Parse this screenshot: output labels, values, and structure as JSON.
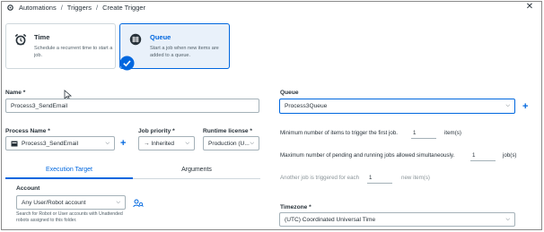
{
  "breadcrumb": {
    "items": [
      "Automations",
      "Triggers",
      "Create Trigger"
    ],
    "separator": "/"
  },
  "close": {
    "glyph": "✕"
  },
  "trigger_types": [
    {
      "title": "Time",
      "description": "Schedule a recurrent time to start a job.",
      "icon": "alarm-clock-icon",
      "selected": false
    },
    {
      "title": "Queue",
      "description": "Start a job when new items are added to a queue.",
      "icon": "queue-icon",
      "selected": true
    }
  ],
  "name": {
    "label": "Name *",
    "value": "Process3_SendEmail"
  },
  "process": {
    "label": "Process Name *",
    "value": "Process3_SendEmail"
  },
  "priority": {
    "label": "Job priority *",
    "value": "→ Inherited"
  },
  "runtime": {
    "label": "Runtime license *",
    "value": "Production (U..."
  },
  "tabs": [
    {
      "label": "Execution Target",
      "active": true
    },
    {
      "label": "Arguments",
      "active": false
    }
  ],
  "account": {
    "label": "Account",
    "value": "Any User/Robot account",
    "hint": "Search for Robot or User accounts with Unattended robots assigned to this folder."
  },
  "queue": {
    "label": "Queue",
    "value": "Process3Queue"
  },
  "rules": [
    {
      "text": "Minimum number of items to trigger the first job.",
      "value": "1",
      "suffix": "item(s)",
      "muted": false
    },
    {
      "text": "Maximum number of pending and running jobs allowed simultaneously.",
      "value": "1",
      "suffix": "job(s)",
      "muted": false
    },
    {
      "text": "Another job is triggered for each",
      "value": "1",
      "suffix": "new item(s)",
      "muted": true
    }
  ],
  "timezone": {
    "label": "Timezone *",
    "value": "(UTC) Coordinated Universal Time"
  },
  "colors": {
    "accent": "#0067df",
    "border": "#a4b1b8",
    "text": "#273139"
  }
}
